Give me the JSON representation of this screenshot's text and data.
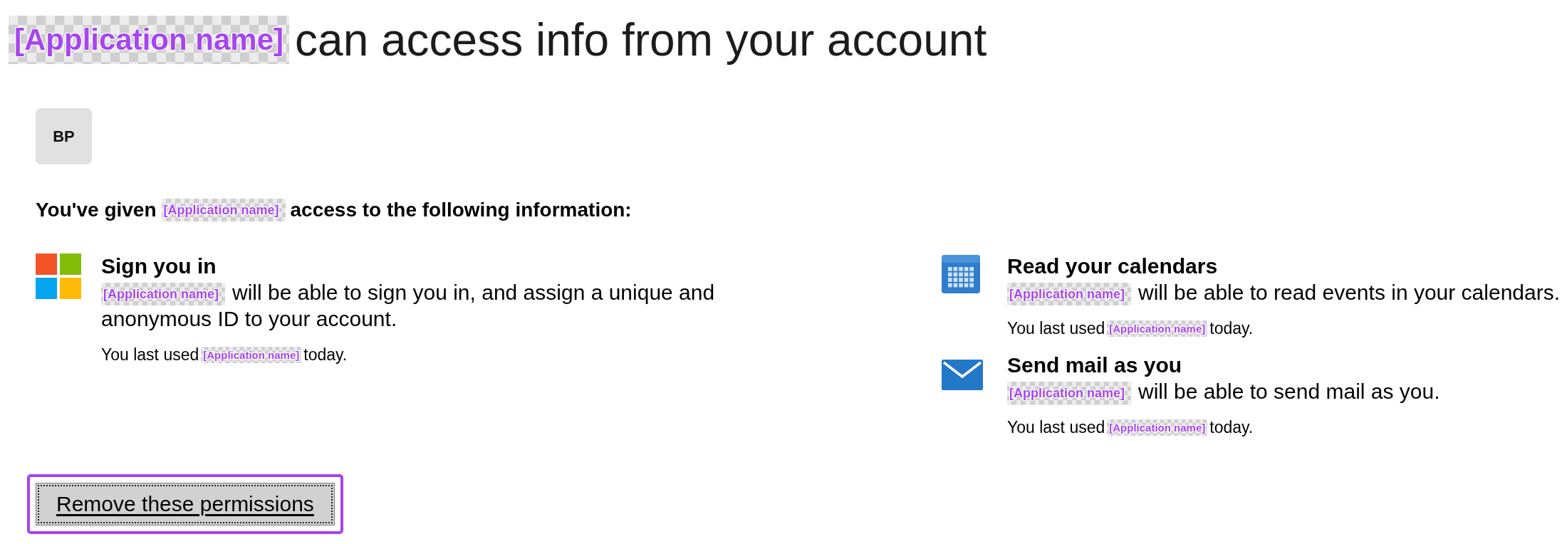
{
  "title": {
    "app_tag": "[Application name]",
    "text": "can access info from your account"
  },
  "avatar": {
    "initials": "BP"
  },
  "intro": {
    "before": "You've given",
    "app_tag": "[Application name]",
    "after": "access to the following information:"
  },
  "columns": [
    {
      "permissions": [
        {
          "kind": "signin",
          "title": "Sign you in",
          "app_tag": "[Application name]",
          "description": "will be able to sign you in, and assign a unique and anonymous ID to your account.",
          "last_used": {
            "before": "You last used",
            "app_tag": "[Application name]",
            "after": "today."
          }
        }
      ]
    },
    {
      "permissions": [
        {
          "kind": "calendar",
          "title": "Read your calendars",
          "app_tag": "[Application name]",
          "description": "will be able to read events in your calendars.",
          "last_used": {
            "before": "You last used",
            "app_tag": "[Application name]",
            "after": "today."
          }
        },
        {
          "kind": "mail",
          "title": "Send mail as you",
          "app_tag": "[Application name]",
          "description": "will be able to send mail as you.",
          "last_used": {
            "before": "You last used",
            "app_tag": "[Application name]",
            "after": "today."
          }
        }
      ]
    }
  ],
  "button": {
    "label": "Remove these permissions",
    "focused": true,
    "highlighted": true
  }
}
